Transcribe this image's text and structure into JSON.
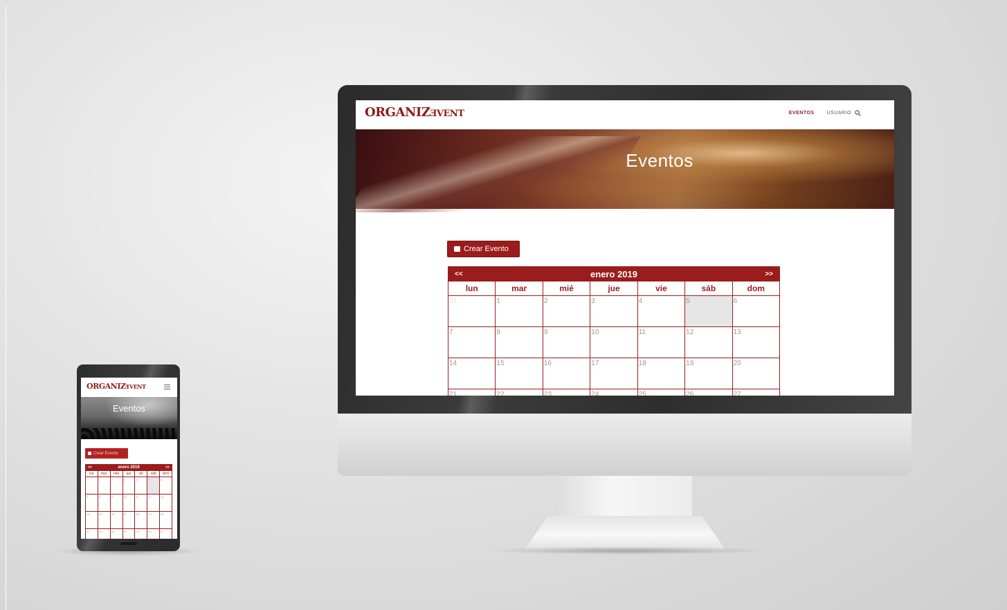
{
  "brand": {
    "main": "ORGANIZ",
    "mirror": "E",
    "tail": "VENT"
  },
  "nav": {
    "items": [
      "EVENTOS",
      "USUARIO"
    ],
    "active": "EVENTOS"
  },
  "hero": {
    "title": "Eventos"
  },
  "create_button": {
    "label": "Crear Evento"
  },
  "calendar": {
    "prev": "<<",
    "next": ">>",
    "month": "enero 2019",
    "weekdays": [
      "lun",
      "mar",
      "mié",
      "jue",
      "vie",
      "sáb",
      "dom"
    ],
    "weeks": [
      [
        "31",
        "1",
        "2",
        "3",
        "4",
        "5",
        "6"
      ],
      [
        "7",
        "8",
        "9",
        "10",
        "11",
        "12",
        "13"
      ],
      [
        "14",
        "15",
        "16",
        "17",
        "18",
        "19",
        "20"
      ],
      [
        "21",
        "22",
        "23",
        "24",
        "25",
        "26",
        "27"
      ]
    ],
    "highlighted_day": "5"
  },
  "colors": {
    "brand_red": "#9b1c1c"
  }
}
